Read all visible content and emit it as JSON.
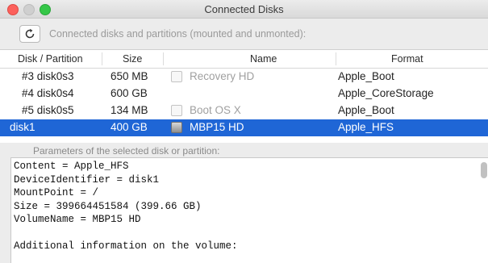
{
  "window": {
    "title": "Connected Disks"
  },
  "toolbar": {
    "label": "Connected disks and partitions (mounted and unmonted):"
  },
  "table": {
    "headers": {
      "disk": "Disk / Partition",
      "size": "Size",
      "name": "Name",
      "format": "Format"
    },
    "rows": [
      {
        "disk": "#3 disk0s3",
        "size": "650 MB",
        "has_checkbox": true,
        "name": "Recovery HD",
        "format": "Apple_Boot",
        "selected": false
      },
      {
        "disk": "#4 disk0s4",
        "size": "600 GB",
        "has_checkbox": false,
        "name": "",
        "format": "Apple_CoreStorage",
        "selected": false
      },
      {
        "disk": "#5 disk0s5",
        "size": "134 MB",
        "has_checkbox": true,
        "name": "Boot OS X",
        "format": "Apple_Boot",
        "selected": false
      },
      {
        "disk": "disk1",
        "size": "400 GB",
        "has_checkbox": true,
        "name": "MBP15 HD",
        "format": "Apple_HFS",
        "selected": true
      }
    ]
  },
  "params": {
    "label": "Parameters of the selected disk or partition:",
    "lines": [
      "Content = Apple_HFS",
      "DeviceIdentifier = disk1",
      "MountPoint = /",
      "Size = 399664451584 (399.66 GB)",
      "VolumeName = MBP15 HD",
      "",
      "Additional information on the volume:"
    ]
  },
  "colors": {
    "selection": "#1f66d6"
  }
}
